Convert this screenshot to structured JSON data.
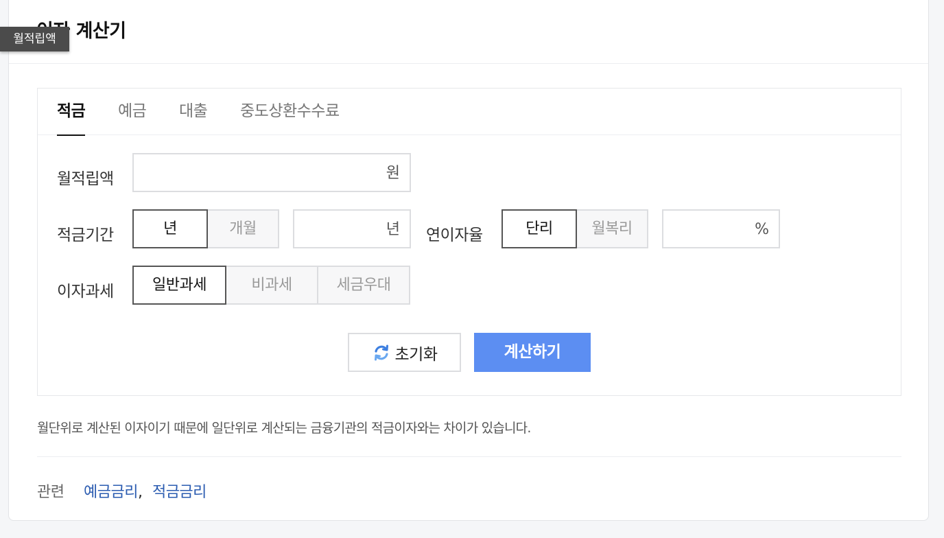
{
  "header": {
    "title": "이자 계산기"
  },
  "tooltip": {
    "text": "월적립액"
  },
  "tabs": [
    {
      "label": "적금",
      "active": true
    },
    {
      "label": "예금",
      "active": false
    },
    {
      "label": "대출",
      "active": false
    },
    {
      "label": "중도상환수수료",
      "active": false
    }
  ],
  "form": {
    "monthly": {
      "label": "월적립액",
      "value": "",
      "unit": "원"
    },
    "period": {
      "label": "적금기간",
      "options": [
        "년",
        "개월"
      ],
      "selected": "년",
      "value": "",
      "unit": "년"
    },
    "rate": {
      "label": "연이자율",
      "options": [
        "단리",
        "월복리"
      ],
      "selected": "단리",
      "value": "",
      "unit": "%"
    },
    "tax": {
      "label": "이자과세",
      "options": [
        "일반과세",
        "비과세",
        "세금우대"
      ],
      "selected": "일반과세"
    }
  },
  "buttons": {
    "reset": "초기화",
    "calculate": "계산하기"
  },
  "note": "월단위로 계산된 이자이기 때문에 일단위로 계산되는 금융기관의 적금이자와는 차이가 있습니다.",
  "related": {
    "label": "관련",
    "links": [
      "예금금리",
      "적금금리"
    ],
    "separator": ","
  },
  "colors": {
    "accent": "#5c8ef2",
    "link": "#2a5bb0"
  }
}
